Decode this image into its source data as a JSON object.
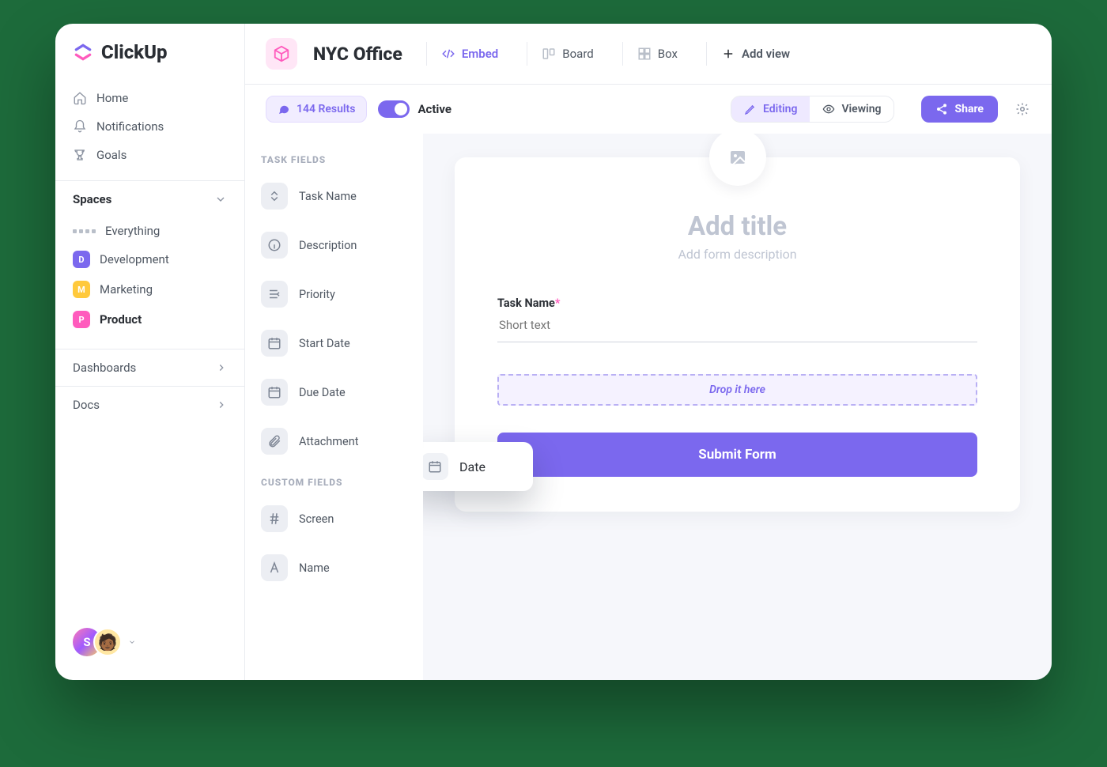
{
  "brand": "ClickUp",
  "sidebar": {
    "nav": [
      {
        "label": "Home",
        "icon": "home-icon"
      },
      {
        "label": "Notifications",
        "icon": "bell-icon"
      },
      {
        "label": "Goals",
        "icon": "trophy-icon"
      }
    ],
    "spaces_label": "Spaces",
    "spaces": [
      {
        "label": "Everything",
        "kind": "all"
      },
      {
        "label": "Development",
        "badge": "D",
        "color": "#7b68ee"
      },
      {
        "label": "Marketing",
        "badge": "M",
        "color": "#ffc93c"
      },
      {
        "label": "Product",
        "badge": "P",
        "color": "#ff5bbd",
        "active": true
      }
    ],
    "dashboards_label": "Dashboards",
    "docs_label": "Docs",
    "user_initial": "S"
  },
  "topbar": {
    "title": "NYC Office",
    "views": [
      {
        "label": "Embed",
        "icon": "embed-icon",
        "accent": true
      },
      {
        "label": "Board",
        "icon": "board-icon"
      },
      {
        "label": "Box",
        "icon": "box-icon"
      }
    ],
    "add_view": "Add view"
  },
  "toolbar": {
    "results_label": "144 Results",
    "active_label": "Active",
    "editing_label": "Editing",
    "viewing_label": "Viewing",
    "share_label": "Share"
  },
  "fields": {
    "task_heading": "TASK FIELDS",
    "task": [
      {
        "label": "Task Name"
      },
      {
        "label": "Description"
      },
      {
        "label": "Priority"
      },
      {
        "label": "Start Date"
      },
      {
        "label": "Due Date"
      },
      {
        "label": "Attachment"
      }
    ],
    "custom_heading": "CUSTOM FIELDS",
    "custom": [
      {
        "label": "Screen"
      },
      {
        "label": "Name"
      }
    ]
  },
  "drag": {
    "label": "Date"
  },
  "form": {
    "title_placeholder": "Add title",
    "subtitle_placeholder": "Add form description",
    "task_name_label": "Task Name",
    "task_name_placeholder": "Short text",
    "drop_hint": "Drop it here",
    "submit_label": "Submit Form"
  },
  "colors": {
    "accent": "#7b68ee",
    "pink": "#ff5bbd"
  }
}
